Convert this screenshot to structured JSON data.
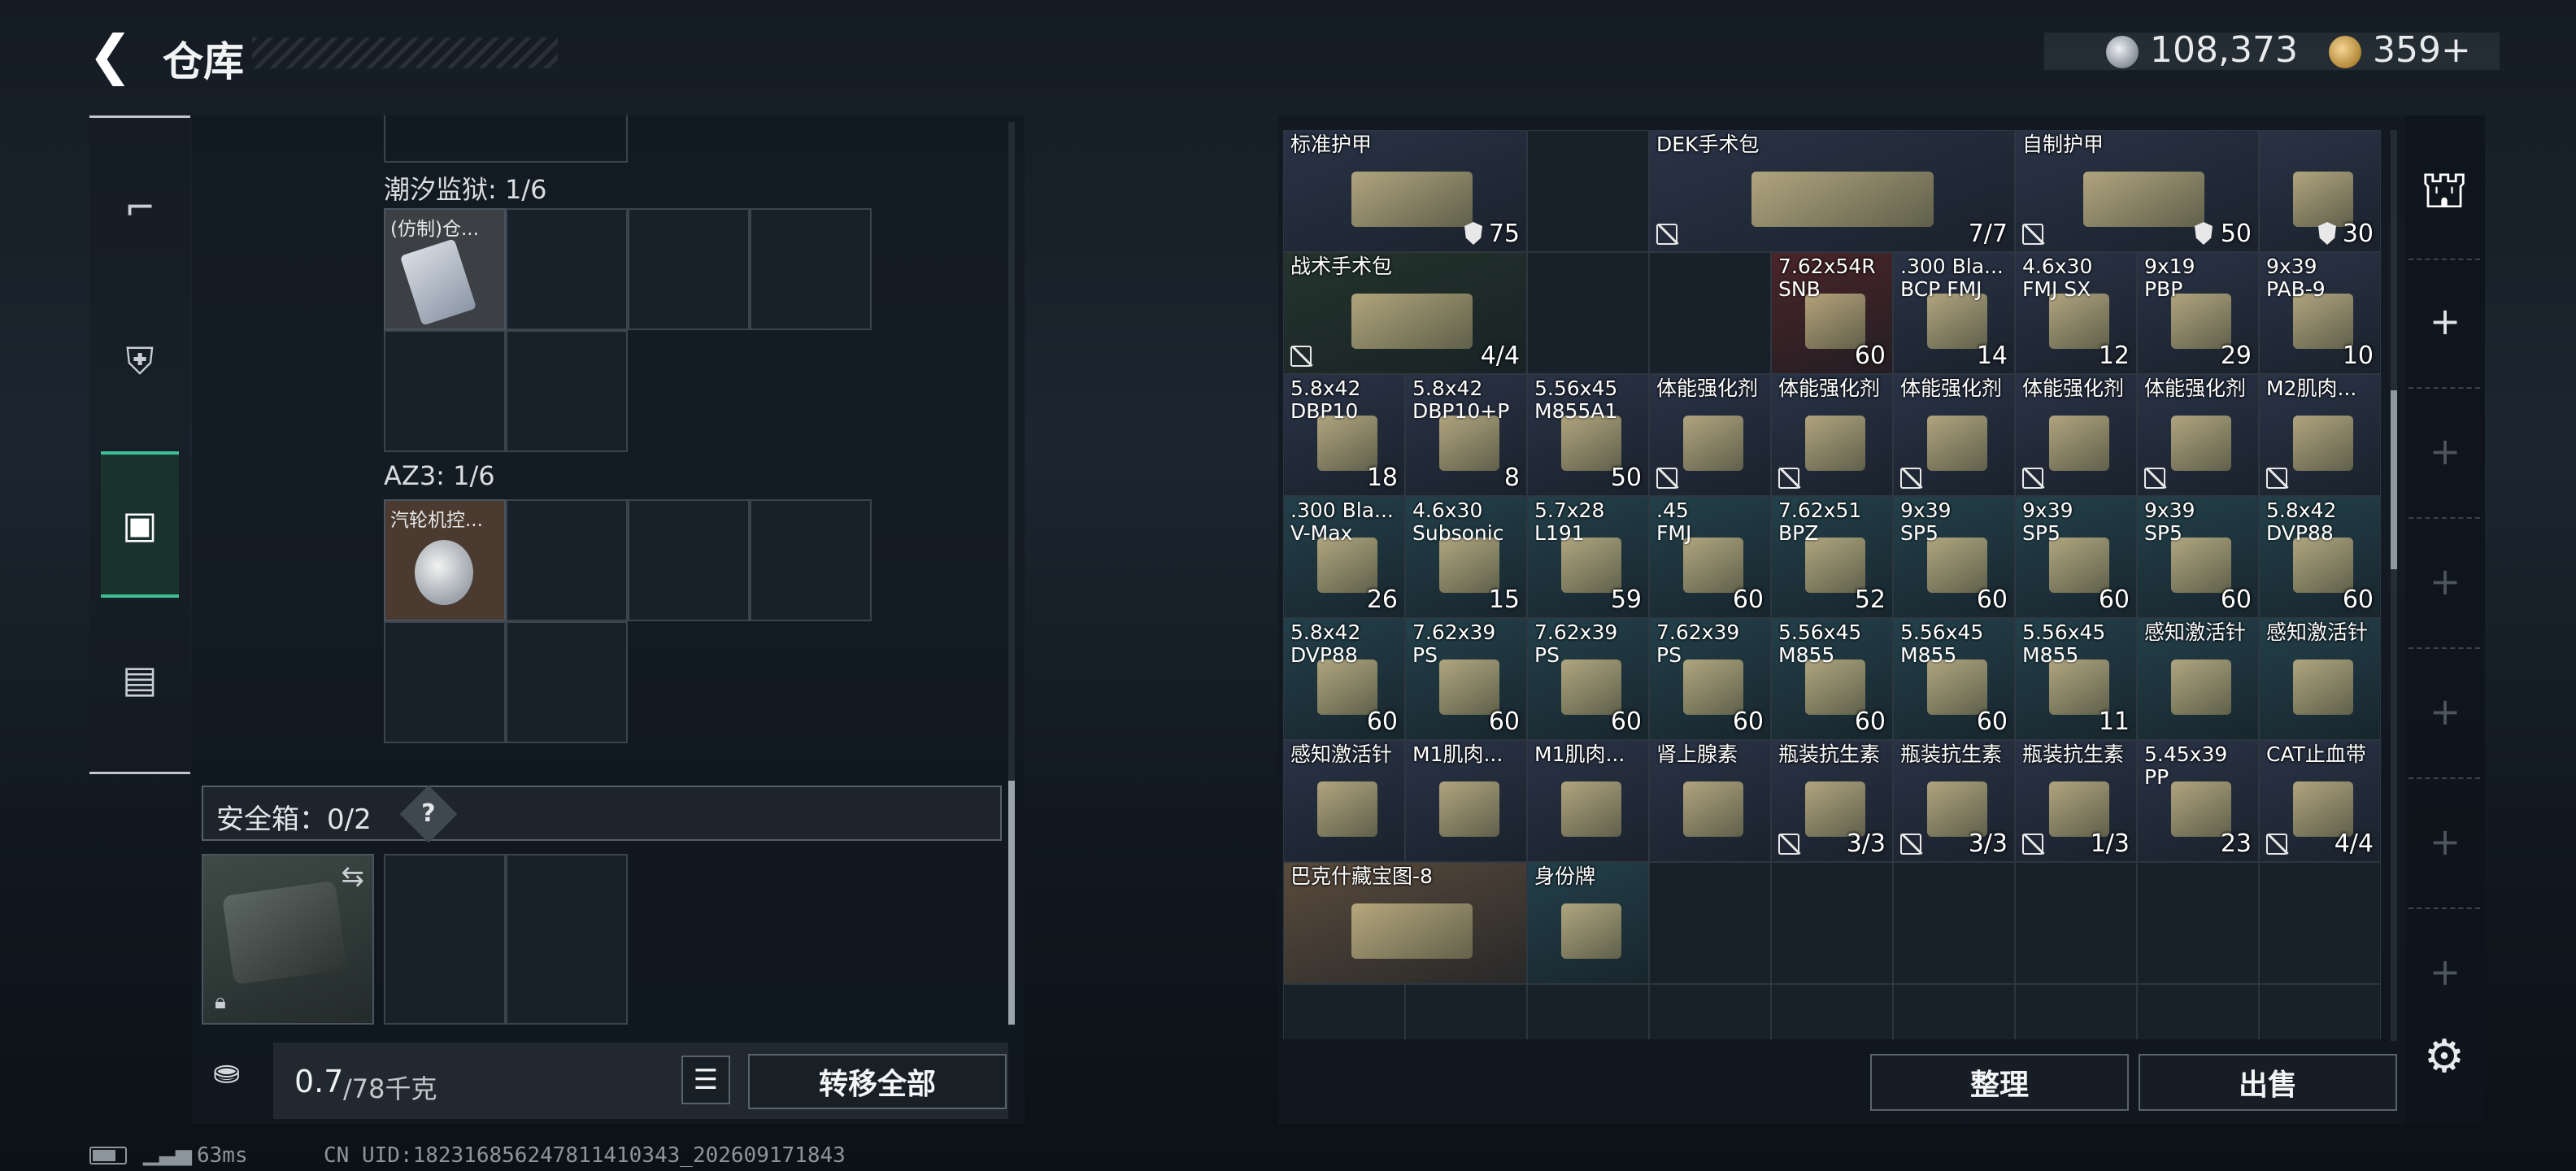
{
  "header": {
    "title": "仓库",
    "back_icon": "back-arrow-icon"
  },
  "currency": {
    "silver": "108,373",
    "gold": "359+"
  },
  "left_nav": [
    {
      "name": "weapon-icon",
      "glyph": "⌐"
    },
    {
      "name": "vest-icon",
      "glyph": "⛨"
    },
    {
      "name": "backpack-icon",
      "glyph": "▣",
      "active": true
    },
    {
      "name": "case-icon",
      "glyph": "▤"
    }
  ],
  "left": {
    "container1": {
      "label": "潮汐监狱: 1/6",
      "item": "(仿制)仓..."
    },
    "container2": {
      "label": "AZ3: 1/6",
      "item": "汽轮机控..."
    },
    "safe": {
      "label": "安全箱：0/2",
      "help": "?"
    },
    "weight": {
      "value": "0.7",
      "max": "/78千克"
    },
    "transfer_all": "转移全部"
  },
  "right": {
    "items": [
      {
        "name": "标准护甲",
        "count": "75",
        "icon": "shield",
        "bg": "#2a3346",
        "r": 0,
        "c": 0,
        "w": 2,
        "h": 1
      },
      {
        "name": "DEK手术包",
        "count": "7/7",
        "icon": "noicon",
        "bg": "#2a3346",
        "r": 0,
        "c": 3,
        "w": 3,
        "h": 1
      },
      {
        "name": "自制护甲",
        "count": "50",
        "icon": "noicon-shield",
        "bg": "#2a3346",
        "r": 0,
        "c": 6,
        "w": 2,
        "h": 1
      },
      {
        "name": "",
        "count": "30",
        "icon": "shield",
        "bg": "#2a3346",
        "r": 0,
        "c": 8,
        "w": 1,
        "h": 1
      },
      {
        "name": "战术手术包",
        "count": "4/4",
        "icon": "noicon",
        "bg": "#24342d",
        "r": 1,
        "c": 0,
        "w": 2,
        "h": 1
      },
      {
        "name": "7.62x54R",
        "name2": "SNB",
        "count": "60",
        "bg": "#4a2528",
        "r": 1,
        "c": 4
      },
      {
        "name": ".300 Bla...",
        "name2": "BCP FMJ",
        "count": "14",
        "bg": "#2a3346",
        "r": 1,
        "c": 5
      },
      {
        "name": "4.6x30",
        "name2": "FMJ SX",
        "count": "12",
        "bg": "#2a3346",
        "r": 1,
        "c": 6
      },
      {
        "name": "9x19",
        "name2": "PBP",
        "count": "29",
        "bg": "#2a3346",
        "r": 1,
        "c": 7
      },
      {
        "name": "9x39",
        "name2": "PAB-9",
        "count": "10",
        "bg": "#2a3346",
        "r": 1,
        "c": 8
      },
      {
        "name": "5.8x42",
        "name2": "DBP10",
        "count": "18",
        "bg": "#2a3346",
        "r": 2,
        "c": 0
      },
      {
        "name": "5.8x42",
        "name2": "DBP10+P",
        "count": "8",
        "bg": "#2a3346",
        "r": 2,
        "c": 1
      },
      {
        "name": "5.56x45",
        "name2": "M855A1",
        "count": "50",
        "bg": "#2a3346",
        "r": 2,
        "c": 2
      },
      {
        "name": "体能强化剂",
        "icon": "noicon",
        "bg": "#2a3346",
        "r": 2,
        "c": 3
      },
      {
        "name": "体能强化剂",
        "icon": "noicon",
        "bg": "#2a3346",
        "r": 2,
        "c": 4
      },
      {
        "name": "体能强化剂",
        "icon": "noicon",
        "bg": "#2a3346",
        "r": 2,
        "c": 5
      },
      {
        "name": "体能强化剂",
        "icon": "noicon",
        "bg": "#2a3346",
        "r": 2,
        "c": 6
      },
      {
        "name": "体能强化剂",
        "icon": "noicon",
        "bg": "#2a3346",
        "r": 2,
        "c": 7
      },
      {
        "name": "M2肌肉...",
        "icon": "noicon",
        "bg": "#2a3346",
        "r": 2,
        "c": 8
      },
      {
        "name": ".300 Bla...",
        "name2": "V-Max",
        "count": "26",
        "bg": "#23404a",
        "r": 3,
        "c": 0
      },
      {
        "name": "4.6x30",
        "name2": "Subsonic",
        "count": "15",
        "bg": "#23404a",
        "r": 3,
        "c": 1
      },
      {
        "name": "5.7x28",
        "name2": "L191",
        "count": "59",
        "bg": "#23404a",
        "r": 3,
        "c": 2
      },
      {
        "name": ".45",
        "name2": "FMJ",
        "count": "60",
        "bg": "#23404a",
        "r": 3,
        "c": 3
      },
      {
        "name": "7.62x51",
        "name2": "BPZ",
        "count": "52",
        "bg": "#23404a",
        "r": 3,
        "c": 4
      },
      {
        "name": "9x39",
        "name2": "SP5",
        "count": "60",
        "bg": "#23404a",
        "r": 3,
        "c": 5
      },
      {
        "name": "9x39",
        "name2": "SP5",
        "count": "60",
        "bg": "#23404a",
        "r": 3,
        "c": 6
      },
      {
        "name": "9x39",
        "name2": "SP5",
        "count": "60",
        "bg": "#23404a",
        "r": 3,
        "c": 7
      },
      {
        "name": "5.8x42",
        "name2": "DVP88",
        "count": "60",
        "bg": "#23404a",
        "r": 3,
        "c": 8
      },
      {
        "name": "5.8x42",
        "name2": "DVP88",
        "count": "60",
        "bg": "#23404a",
        "r": 4,
        "c": 0
      },
      {
        "name": "7.62x39",
        "name2": "PS",
        "count": "60",
        "bg": "#23404a",
        "r": 4,
        "c": 1
      },
      {
        "name": "7.62x39",
        "name2": "PS",
        "count": "60",
        "bg": "#23404a",
        "r": 4,
        "c": 2
      },
      {
        "name": "7.62x39",
        "name2": "PS",
        "count": "60",
        "bg": "#23404a",
        "r": 4,
        "c": 3
      },
      {
        "name": "5.56x45",
        "name2": "M855",
        "count": "60",
        "bg": "#23404a",
        "r": 4,
        "c": 4
      },
      {
        "name": "5.56x45",
        "name2": "M855",
        "count": "60",
        "bg": "#23404a",
        "r": 4,
        "c": 5
      },
      {
        "name": "5.56x45",
        "name2": "M855",
        "count": "11",
        "bg": "#23404a",
        "r": 4,
        "c": 6
      },
      {
        "name": "感知激活针",
        "bg": "#23404a",
        "r": 4,
        "c": 7
      },
      {
        "name": "感知激活针",
        "bg": "#23404a",
        "r": 4,
        "c": 8
      },
      {
        "name": "感知激活针",
        "bg": "#2a3346",
        "r": 5,
        "c": 0
      },
      {
        "name": "M1肌肉...",
        "bg": "#2a3346",
        "r": 5,
        "c": 1
      },
      {
        "name": "M1肌肉...",
        "bg": "#2a3346",
        "r": 5,
        "c": 2
      },
      {
        "name": "肾上腺素",
        "bg": "#2a3346",
        "r": 5,
        "c": 3
      },
      {
        "name": "瓶装抗生素",
        "count": "3/3",
        "icon": "noicon",
        "bg": "#2a3346",
        "r": 5,
        "c": 4
      },
      {
        "name": "瓶装抗生素",
        "count": "3/3",
        "icon": "noicon",
        "bg": "#2a3346",
        "r": 5,
        "c": 5
      },
      {
        "name": "瓶装抗生素",
        "count": "1/3",
        "icon": "noicon",
        "bg": "#2a3346",
        "r": 5,
        "c": 6
      },
      {
        "name": "5.45x39",
        "name2": "PP",
        "count": "23",
        "bg": "#2a3346",
        "r": 5,
        "c": 7
      },
      {
        "name": "CAT止血带",
        "count": "4/4",
        "icon": "noicon",
        "bg": "#2a3346",
        "r": 5,
        "c": 8
      },
      {
        "name": "巴克什藏宝图-8",
        "bg": "#5a4b3c",
        "r": 6,
        "c": 0,
        "w": 2,
        "h": 1
      },
      {
        "name": "身份牌",
        "bg": "#23404a",
        "r": 6,
        "c": 2
      }
    ],
    "sort": "整理",
    "sell": "出售"
  },
  "status": {
    "ping": "63ms",
    "uid": "CN UID:182316856247811410343_202609171843"
  }
}
